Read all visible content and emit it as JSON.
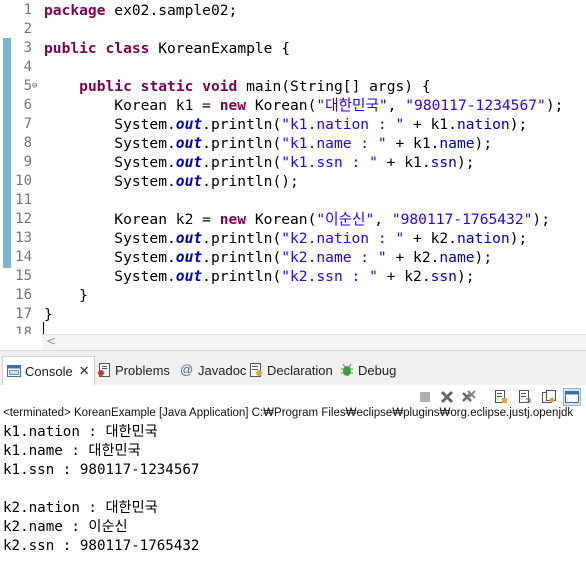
{
  "editor": {
    "line_numbers": [
      "1",
      "2",
      "3",
      "4",
      "5",
      "6",
      "7",
      "8",
      "9",
      "10",
      "11",
      "12",
      "13",
      "14",
      "15",
      "16",
      "17",
      "18"
    ],
    "fold_marker": "⊖",
    "lines": [
      [
        {
          "t": "package",
          "c": "kw"
        },
        {
          "t": " ex02.sample02;"
        }
      ],
      [],
      [
        {
          "t": "public",
          "c": "kw"
        },
        {
          "t": " "
        },
        {
          "t": "class",
          "c": "kw"
        },
        {
          "t": " KoreanExample {"
        }
      ],
      [],
      [
        {
          "t": "    "
        },
        {
          "t": "public",
          "c": "kw"
        },
        {
          "t": " "
        },
        {
          "t": "static",
          "c": "kw"
        },
        {
          "t": " "
        },
        {
          "t": "void",
          "c": "kw"
        },
        {
          "t": " main(String[] args) {"
        }
      ],
      [
        {
          "t": "        Korean k1 = "
        },
        {
          "t": "new",
          "c": "kw"
        },
        {
          "t": " Korean("
        },
        {
          "t": "\"대한민국\"",
          "c": "st"
        },
        {
          "t": ", "
        },
        {
          "t": "\"980117-1234567\"",
          "c": "st"
        },
        {
          "t": ");"
        }
      ],
      [
        {
          "t": "        System."
        },
        {
          "t": "out",
          "c": "sfld"
        },
        {
          "t": ".println("
        },
        {
          "t": "\"k1.nation : \"",
          "c": "st"
        },
        {
          "t": " + k1."
        },
        {
          "t": "nation",
          "c": "fld"
        },
        {
          "t": ");"
        }
      ],
      [
        {
          "t": "        System."
        },
        {
          "t": "out",
          "c": "sfld"
        },
        {
          "t": ".println("
        },
        {
          "t": "\"k1.name : \"",
          "c": "st"
        },
        {
          "t": " + k1."
        },
        {
          "t": "name",
          "c": "fld"
        },
        {
          "t": ");"
        }
      ],
      [
        {
          "t": "        System."
        },
        {
          "t": "out",
          "c": "sfld"
        },
        {
          "t": ".println("
        },
        {
          "t": "\"k1.ssn : \"",
          "c": "st"
        },
        {
          "t": " + k1."
        },
        {
          "t": "ssn",
          "c": "fld"
        },
        {
          "t": ");"
        }
      ],
      [
        {
          "t": "        System."
        },
        {
          "t": "out",
          "c": "sfld"
        },
        {
          "t": ".println();"
        }
      ],
      [],
      [
        {
          "t": "        Korean k2 = "
        },
        {
          "t": "new",
          "c": "kw"
        },
        {
          "t": " Korean("
        },
        {
          "t": "\"이순신\"",
          "c": "st"
        },
        {
          "t": ", "
        },
        {
          "t": "\"980117-1765432\"",
          "c": "st"
        },
        {
          "t": ");"
        }
      ],
      [
        {
          "t": "        System."
        },
        {
          "t": "out",
          "c": "sfld"
        },
        {
          "t": ".println("
        },
        {
          "t": "\"k2.nation : \"",
          "c": "st"
        },
        {
          "t": " + k2."
        },
        {
          "t": "nation",
          "c": "fld"
        },
        {
          "t": ");"
        }
      ],
      [
        {
          "t": "        System."
        },
        {
          "t": "out",
          "c": "sfld"
        },
        {
          "t": ".println("
        },
        {
          "t": "\"k2.name : \"",
          "c": "st"
        },
        {
          "t": " + k2."
        },
        {
          "t": "name",
          "c": "fld"
        },
        {
          "t": ");"
        }
      ],
      [
        {
          "t": "        System."
        },
        {
          "t": "out",
          "c": "sfld"
        },
        {
          "t": ".println("
        },
        {
          "t": "\"k2.ssn : \"",
          "c": "st"
        },
        {
          "t": " + k2."
        },
        {
          "t": "ssn",
          "c": "fld"
        },
        {
          "t": ");"
        }
      ],
      [
        {
          "t": "    }"
        }
      ],
      [
        {
          "t": "}"
        }
      ],
      []
    ],
    "scroll_left_arrow": "<"
  },
  "views": {
    "tabs": [
      {
        "label": "Console",
        "icon": "console-icon",
        "active": true,
        "close": "✕"
      },
      {
        "label": "Problems",
        "icon": "problems-icon"
      },
      {
        "label": "Javadoc",
        "icon": "at-icon",
        "glyph": "@"
      },
      {
        "label": "Declaration",
        "icon": "declaration-icon"
      },
      {
        "label": "Debug",
        "icon": "bug-icon"
      }
    ],
    "toolbar_icons": [
      "terminate-icon",
      "remove-launch-icon",
      "remove-all-terminated-icon",
      "scroll-lock-icon",
      "word-wrap-icon",
      "pin-console-icon",
      "display-selected-console-icon"
    ],
    "status": "<terminated> KoreanExample [Java Application] C:₩Program Files₩eclipse₩plugins₩org.eclipse.justj.openjdk",
    "output": [
      "k1.nation : 대한민국",
      "k1.name : 대한민국",
      "k1.ssn : 980117-1234567",
      "",
      "k2.nation : 대한민국",
      "k2.name : 이순신",
      "k2.ssn : 980117-1765432"
    ]
  },
  "colors": {
    "keyword": "#7f0055",
    "string": "#2a00ff",
    "field": "#0000c0",
    "ruler": "#7bb7cf"
  }
}
